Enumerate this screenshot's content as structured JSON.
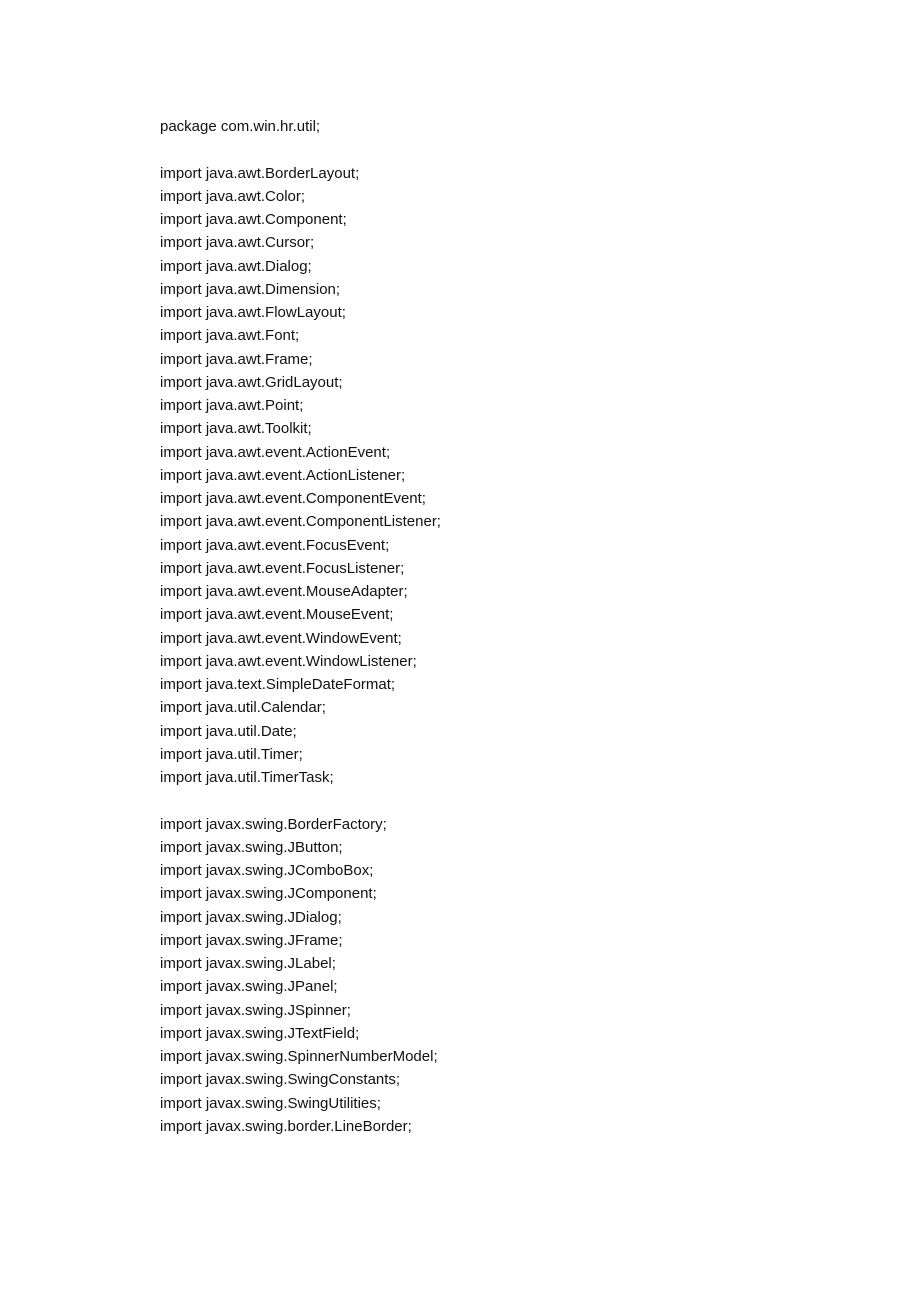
{
  "code": {
    "lines": [
      "package com.win.hr.util;",
      "",
      "import java.awt.BorderLayout;",
      "import java.awt.Color;",
      "import java.awt.Component;",
      "import java.awt.Cursor;",
      "import java.awt.Dialog;",
      "import java.awt.Dimension;",
      "import java.awt.FlowLayout;",
      "import java.awt.Font;",
      "import java.awt.Frame;",
      "import java.awt.GridLayout;",
      "import java.awt.Point;",
      "import java.awt.Toolkit;",
      "import java.awt.event.ActionEvent;",
      "import java.awt.event.ActionListener;",
      "import java.awt.event.ComponentEvent;",
      "import java.awt.event.ComponentListener;",
      "import java.awt.event.FocusEvent;",
      "import java.awt.event.FocusListener;",
      "import java.awt.event.MouseAdapter;",
      "import java.awt.event.MouseEvent;",
      "import java.awt.event.WindowEvent;",
      "import java.awt.event.WindowListener;",
      "import java.text.SimpleDateFormat;",
      "import java.util.Calendar;",
      "import java.util.Date;",
      "import java.util.Timer;",
      "import java.util.TimerTask;",
      "",
      "import javax.swing.BorderFactory;",
      "import javax.swing.JButton;",
      "import javax.swing.JComboBox;",
      "import javax.swing.JComponent;",
      "import javax.swing.JDialog;",
      "import javax.swing.JFrame;",
      "import javax.swing.JLabel;",
      "import javax.swing.JPanel;",
      "import javax.swing.JSpinner;",
      "import javax.swing.JTextField;",
      "import javax.swing.SpinnerNumberModel;",
      "import javax.swing.SwingConstants;",
      "import javax.swing.SwingUtilities;",
      "import javax.swing.border.LineBorder;"
    ]
  }
}
